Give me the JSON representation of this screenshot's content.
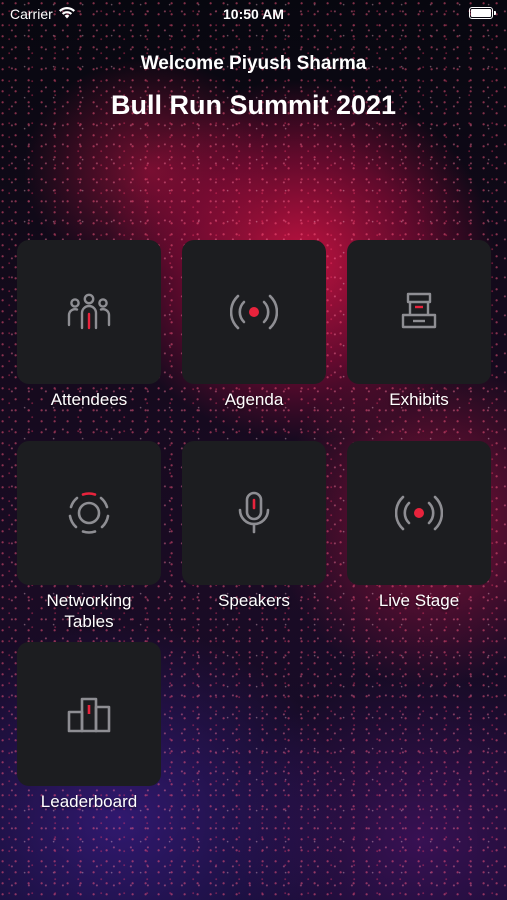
{
  "status_bar": {
    "carrier": "Carrier",
    "time": "10:50 AM"
  },
  "header": {
    "welcome": "Welcome Piyush Sharma",
    "event_title": "Bull Run Summit 2021"
  },
  "tiles": [
    {
      "label": "Attendees",
      "icon": "people-icon"
    },
    {
      "label": "Agenda",
      "icon": "broadcast-icon"
    },
    {
      "label": "Exhibits",
      "icon": "booth-icon"
    },
    {
      "label": "Networking Tables",
      "icon": "round-table-icon"
    },
    {
      "label": "Speakers",
      "icon": "microphone-icon"
    },
    {
      "label": "Live Stage",
      "icon": "broadcast-icon"
    },
    {
      "label": "Leaderboard",
      "icon": "podium-icon"
    }
  ],
  "colors": {
    "tile_bg": "#1c1d20",
    "icon_gray": "#8e8e93",
    "accent_red": "#e8233c"
  }
}
